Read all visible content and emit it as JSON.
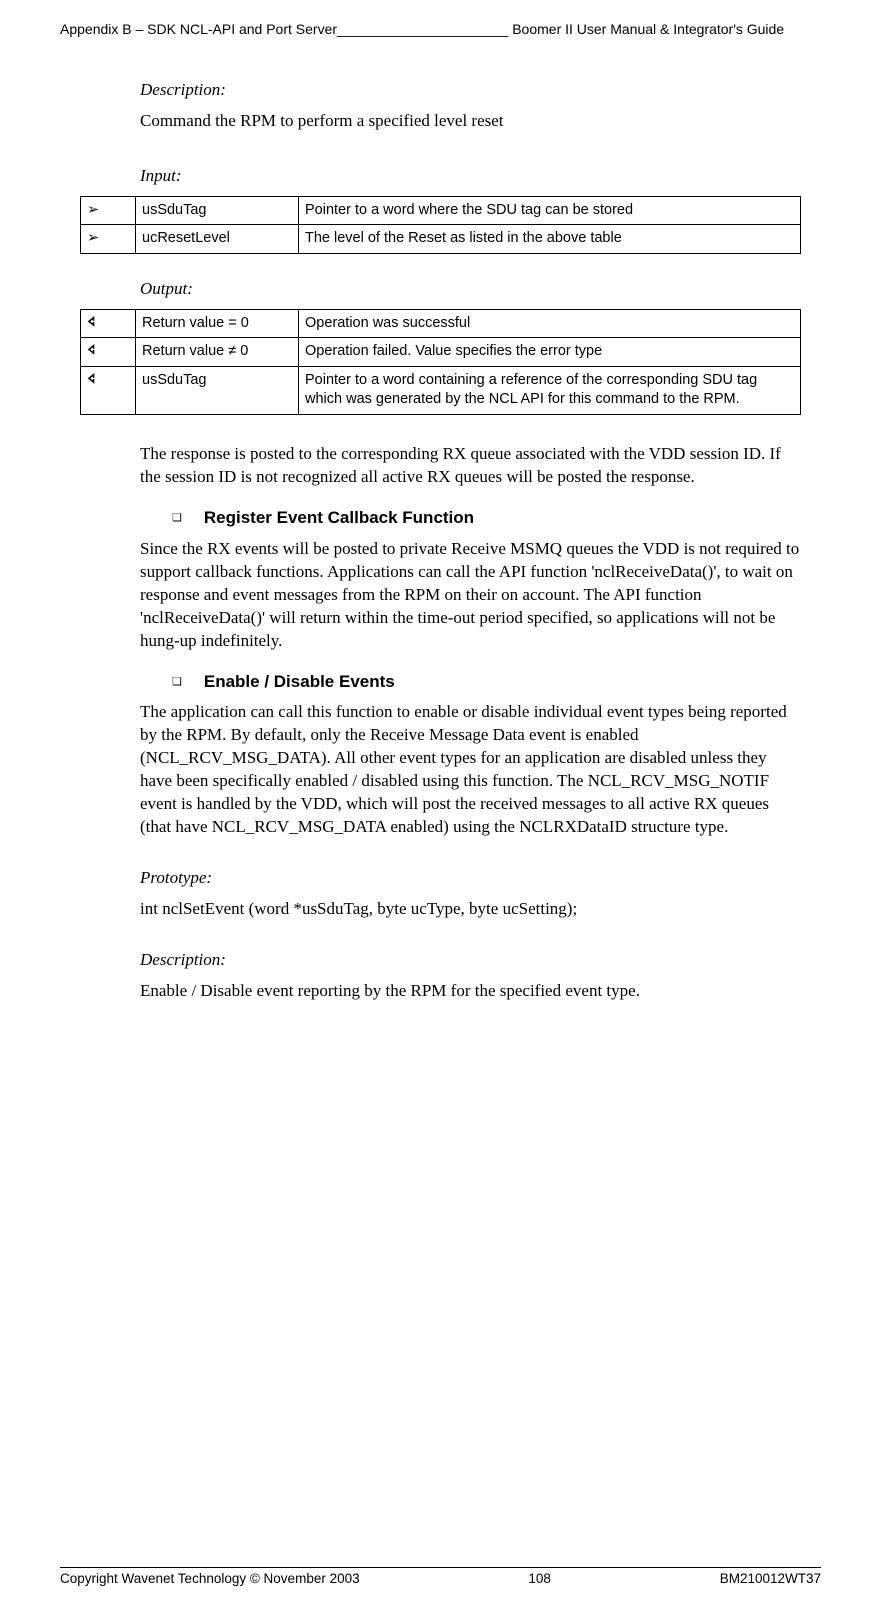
{
  "header": "Appendix B – SDK NCL-API and Port Server______________________ Boomer II User Manual & Integrator's Guide",
  "sections": {
    "description_label": "Description:",
    "description_text": "Command the RPM to perform a specified level reset",
    "input_label": "Input:",
    "input_rows": [
      {
        "sym": "➢",
        "name": "usSduTag",
        "desc": "Pointer to a word where the SDU tag can be stored"
      },
      {
        "sym": "➢",
        "name": "ucResetLevel",
        "desc": "The level of the Reset as listed in the above table"
      }
    ],
    "output_label": "Output:",
    "output_rows": [
      {
        "sym": "🢔",
        "name": "Return value = 0",
        "desc": "Operation was successful"
      },
      {
        "sym": "🢔",
        "name": "Return value  ≠ 0",
        "desc": "Operation failed. Value specifies the error type"
      },
      {
        "sym": "🢔",
        "name": "usSduTag",
        "desc": "Pointer to a word containing a reference of the corresponding SDU tag which was generated by the NCL API for this command to the RPM."
      }
    ],
    "response_paragraph": "The response is posted to the corresponding RX queue associated with the VDD session ID. If the session ID is not recognized all active RX queues will be posted the response.",
    "sub1_marker": "❏",
    "sub1_title": "Register Event Callback Function",
    "sub1_text": "Since the RX events will be posted to private Receive MSMQ queues the VDD is not required to support callback functions. Applications can call the API function 'nclReceiveData()', to wait on response and event messages from the RPM on their on account. The API function 'nclReceiveData()' will return within the time-out period specified, so applications will not be hung-up indefinitely.",
    "sub2_marker": "❏",
    "sub2_title": "Enable / Disable Events",
    "sub2_text": "The application can call this function to enable or disable individual event types being reported by the RPM. By default, only the Receive Message Data event is enabled (NCL_RCV_MSG_DATA). All other event types for an application are disabled unless they have been specifically enabled / disabled using this function. The NCL_RCV_MSG_NOTIF event is handled by the VDD, which will post the received messages to all active RX queues (that have NCL_RCV_MSG_DATA enabled) using the NCLRXDataID structure type.",
    "prototype_label": "Prototype:",
    "prototype_text": "int nclSetEvent (word *usSduTag, byte ucType, byte ucSetting);",
    "description2_label": "Description:",
    "description2_text": "Enable / Disable event reporting by the RPM for the specified event type."
  },
  "footer": {
    "left": "Copyright Wavenet Technology © November 2003",
    "center": "108",
    "right": "BM210012WT37"
  }
}
